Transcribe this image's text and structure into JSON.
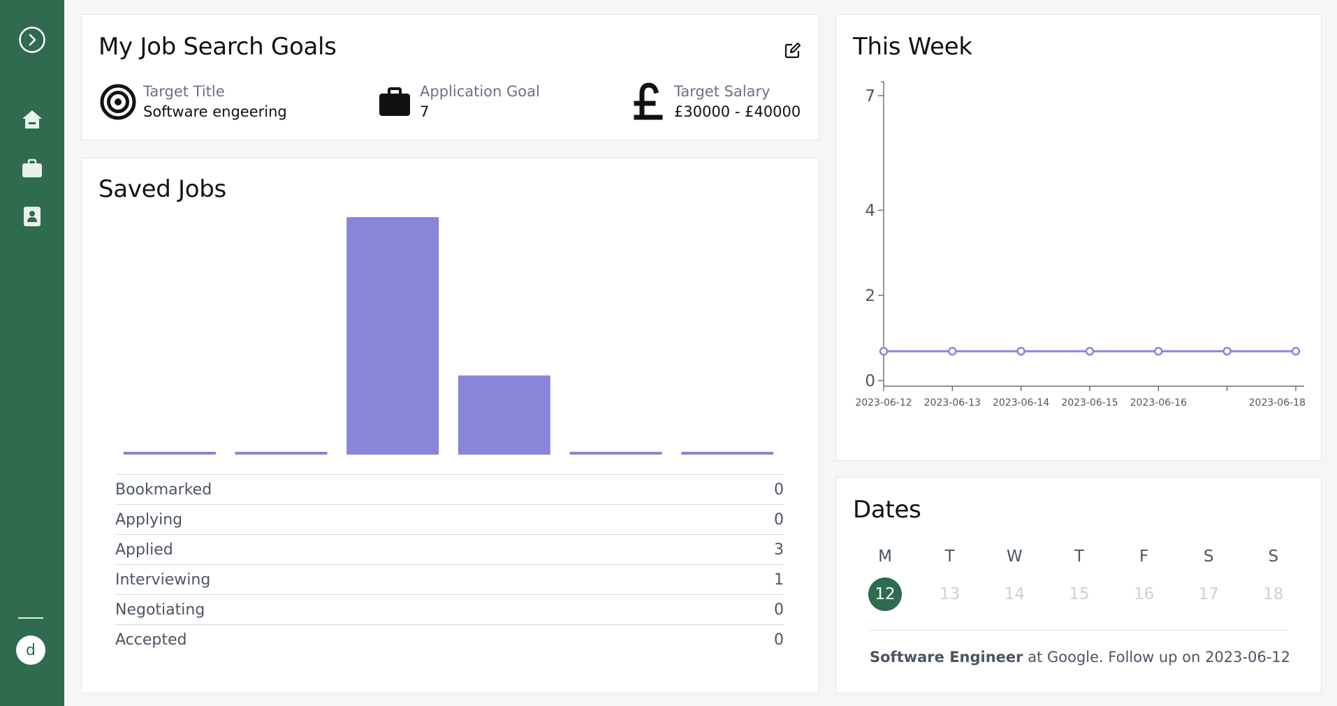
{
  "sidebar": {
    "toggle_icon": "chevron-right-circle-icon",
    "items": [
      {
        "name": "home",
        "icon": "home-icon"
      },
      {
        "name": "jobs",
        "icon": "briefcase-icon"
      },
      {
        "name": "contacts",
        "icon": "contact-book-icon"
      }
    ],
    "avatar_letter": "d"
  },
  "goals": {
    "title": "My Job Search Goals",
    "edit_icon": "edit-icon",
    "items": [
      {
        "label": "Target Title",
        "value": "Software engeering",
        "icon": "target-icon"
      },
      {
        "label": "Application Goal",
        "value": "7",
        "icon": "briefcase-icon"
      },
      {
        "label": "Target Salary",
        "value": "£30000 - £40000",
        "icon": "pound-icon"
      }
    ]
  },
  "saved_jobs": {
    "title": "Saved Jobs",
    "rows": [
      {
        "label": "Bookmarked",
        "count": "0"
      },
      {
        "label": "Applying",
        "count": "0"
      },
      {
        "label": "Applied",
        "count": "3"
      },
      {
        "label": "Interviewing",
        "count": "1"
      },
      {
        "label": "Negotiating",
        "count": "0"
      },
      {
        "label": "Accepted",
        "count": "0"
      }
    ]
  },
  "this_week": {
    "title": "This Week"
  },
  "dates": {
    "title": "Dates",
    "days": [
      {
        "head": "M",
        "num": "12",
        "active": true
      },
      {
        "head": "T",
        "num": "13",
        "active": false
      },
      {
        "head": "W",
        "num": "14",
        "active": false
      },
      {
        "head": "T",
        "num": "15",
        "active": false
      },
      {
        "head": "F",
        "num": "16",
        "active": false
      },
      {
        "head": "S",
        "num": "17",
        "active": false
      },
      {
        "head": "S",
        "num": "18",
        "active": false
      }
    ],
    "event": {
      "title": "Software Engineer",
      "text": " at Google. Follow up on 2023-06-12"
    }
  },
  "colors": {
    "sidebar": "#2f6b4f",
    "accent": "#8985d8",
    "active_day": "#2f6b4f"
  },
  "chart_data": [
    {
      "type": "bar",
      "categories": [
        "Bookmarked",
        "Applying",
        "Applied",
        "Interviewing",
        "Negotiating",
        "Accepted"
      ],
      "values": [
        0,
        0,
        3,
        1,
        0,
        0
      ],
      "title": "Saved Jobs",
      "ylim": [
        0,
        3
      ]
    },
    {
      "type": "line",
      "title": "This Week",
      "x": [
        "2023-06-12",
        "2023-06-13",
        "2023-06-14",
        "2023-06-15",
        "2023-06-16",
        "2023-06-17",
        "2023-06-18"
      ],
      "x_tick_labels": [
        "2023-06-12",
        "2023-06-13",
        "2023-06-14",
        "2023-06-15",
        "2023-06-16",
        "2023-06-18"
      ],
      "y": [
        1,
        1,
        1,
        1,
        1,
        1,
        1
      ],
      "y_ticks": [
        0,
        2,
        4,
        7
      ],
      "ylim": [
        0,
        7
      ],
      "grid": false
    }
  ]
}
